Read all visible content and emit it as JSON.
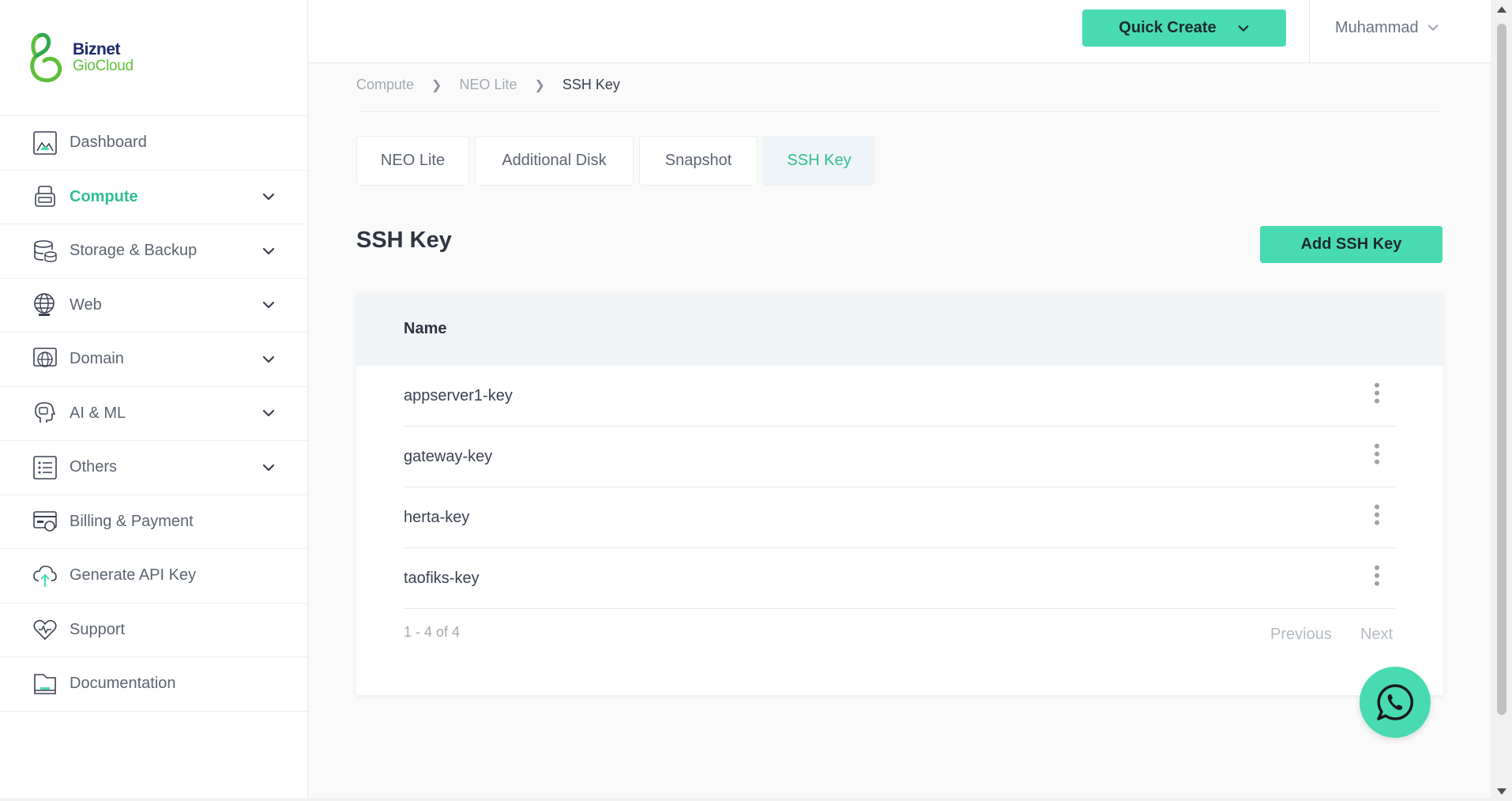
{
  "brand": {
    "line1": "Biznet",
    "line2": "GioCloud"
  },
  "sidebar": {
    "items": [
      {
        "label": "Dashboard",
        "icon": "dashboard-icon",
        "has_chevron": false
      },
      {
        "label": "Compute",
        "icon": "compute-icon",
        "has_chevron": true,
        "active": true
      },
      {
        "label": "Storage & Backup",
        "icon": "storage-icon",
        "has_chevron": true
      },
      {
        "label": "Web",
        "icon": "web-globe-icon",
        "has_chevron": true
      },
      {
        "label": "Domain",
        "icon": "domain-globe-icon",
        "has_chevron": true
      },
      {
        "label": "AI & ML",
        "icon": "ai-head-icon",
        "has_chevron": true
      },
      {
        "label": "Others",
        "icon": "list-icon",
        "has_chevron": true
      },
      {
        "label": "Billing & Payment",
        "icon": "billing-card-icon",
        "has_chevron": false
      },
      {
        "label": "Generate API Key",
        "icon": "cloud-upload-icon",
        "has_chevron": false
      },
      {
        "label": "Support",
        "icon": "support-heart-icon",
        "has_chevron": false
      },
      {
        "label": "Documentation",
        "icon": "folder-icon",
        "has_chevron": false
      }
    ]
  },
  "header": {
    "quick_create": "Quick Create",
    "user": "Muhammad"
  },
  "breadcrumb": [
    "Compute",
    "NEO Lite",
    "SSH Key"
  ],
  "tabs": [
    {
      "label": "NEO Lite",
      "active": false
    },
    {
      "label": "Additional Disk",
      "active": false
    },
    {
      "label": "Snapshot",
      "active": false
    },
    {
      "label": "SSH Key",
      "active": true
    }
  ],
  "page": {
    "title": "SSH Key",
    "add_button": "Add SSH Key"
  },
  "table": {
    "column": "Name",
    "rows": [
      "appserver1-key",
      "gateway-key",
      "herta-key",
      "taofiks-key"
    ],
    "pager_info": "1 - 4 of 4",
    "prev": "Previous",
    "next": "Next"
  },
  "colors": {
    "accent": "#48dbb2",
    "active_text": "#2fbf8f"
  }
}
